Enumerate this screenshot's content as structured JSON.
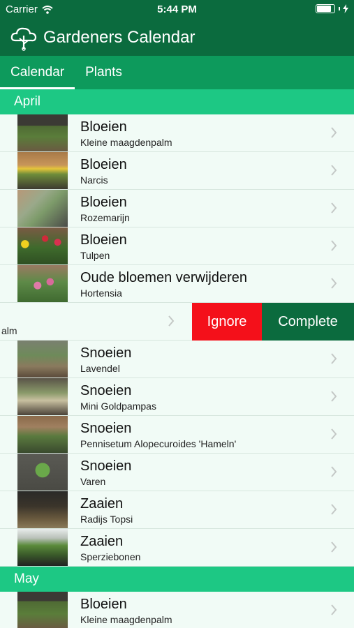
{
  "status": {
    "carrier": "Carrier",
    "time": "5:44 PM"
  },
  "app": {
    "title": "Gardeners Calendar",
    "logo_icon": "tree-cloud-icon"
  },
  "tabs": [
    {
      "label": "Calendar",
      "active": true
    },
    {
      "label": "Plants",
      "active": false
    }
  ],
  "colors": {
    "header": "#0b6b3e",
    "tabs": "#0d9a5c",
    "section": "#1dc884",
    "background": "#f1fbf6",
    "ignore": "#f4101a",
    "complete": "#0b6b3e"
  },
  "sections": [
    {
      "label": "April"
    },
    {
      "label": "May"
    }
  ],
  "rows": [
    {
      "title": "Bloeien",
      "subtitle": "Kleine maagdenpalm"
    },
    {
      "title": "Bloeien",
      "subtitle": "Narcis"
    },
    {
      "title": "Bloeien",
      "subtitle": "Rozemarijn"
    },
    {
      "title": "Bloeien",
      "subtitle": "Tulpen"
    },
    {
      "title": "Oude bloemen verwijderen",
      "subtitle": "Hortensia"
    },
    {
      "title": "Snoeien",
      "subtitle": "Lavendel"
    },
    {
      "title": "Snoeien",
      "subtitle": "Mini Goldpampas"
    },
    {
      "title": "Snoeien",
      "subtitle": "Pennisetum Alopecuroides 'Hameln'"
    },
    {
      "title": "Snoeien",
      "subtitle": "Varen"
    },
    {
      "title": "Zaaien",
      "subtitle": "Radijs Topsi"
    },
    {
      "title": "Zaaien",
      "subtitle": "Sperziebonen"
    },
    {
      "title": "Bloeien",
      "subtitle": "Kleine maagdenpalm"
    }
  ],
  "swipe": {
    "partial_text": "alm",
    "ignore_label": "Ignore",
    "complete_label": "Complete"
  }
}
